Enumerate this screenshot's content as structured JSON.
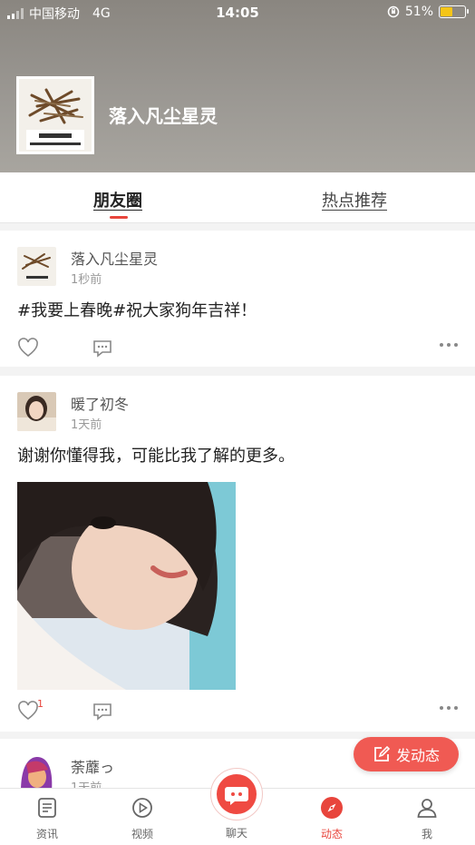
{
  "status_bar": {
    "carrier": "中国移动",
    "network": "4G",
    "time": "14:05",
    "battery_percent": "51%",
    "battery_level": 0.51
  },
  "profile": {
    "name": "落入凡尘星灵"
  },
  "tabs": [
    {
      "label": "朋友圈",
      "active": true
    },
    {
      "label": "热点推荐",
      "active": false
    }
  ],
  "posts": [
    {
      "author": "落入凡尘星灵",
      "time": "1秒前",
      "content": "#我要上春晚#祝大家狗年吉祥！",
      "likes": ""
    },
    {
      "author": "暖了初冬",
      "time": "1天前",
      "content": "谢谢你懂得我，可能比我了解的更多。",
      "likes": "1"
    },
    {
      "author": "荼蘼っ",
      "time": "1天前"
    }
  ],
  "fab": {
    "label": "发动态"
  },
  "bottom_nav": [
    {
      "label": "资讯",
      "icon": "news-icon"
    },
    {
      "label": "视频",
      "icon": "video-icon"
    },
    {
      "label": "聊天",
      "icon": "chat-icon"
    },
    {
      "label": "动态",
      "icon": "compass-icon",
      "active": true
    },
    {
      "label": "我",
      "icon": "person-icon"
    }
  ],
  "colors": {
    "accent": "#e8453c",
    "fab": "#f05a53",
    "battery": "#f5c518"
  }
}
